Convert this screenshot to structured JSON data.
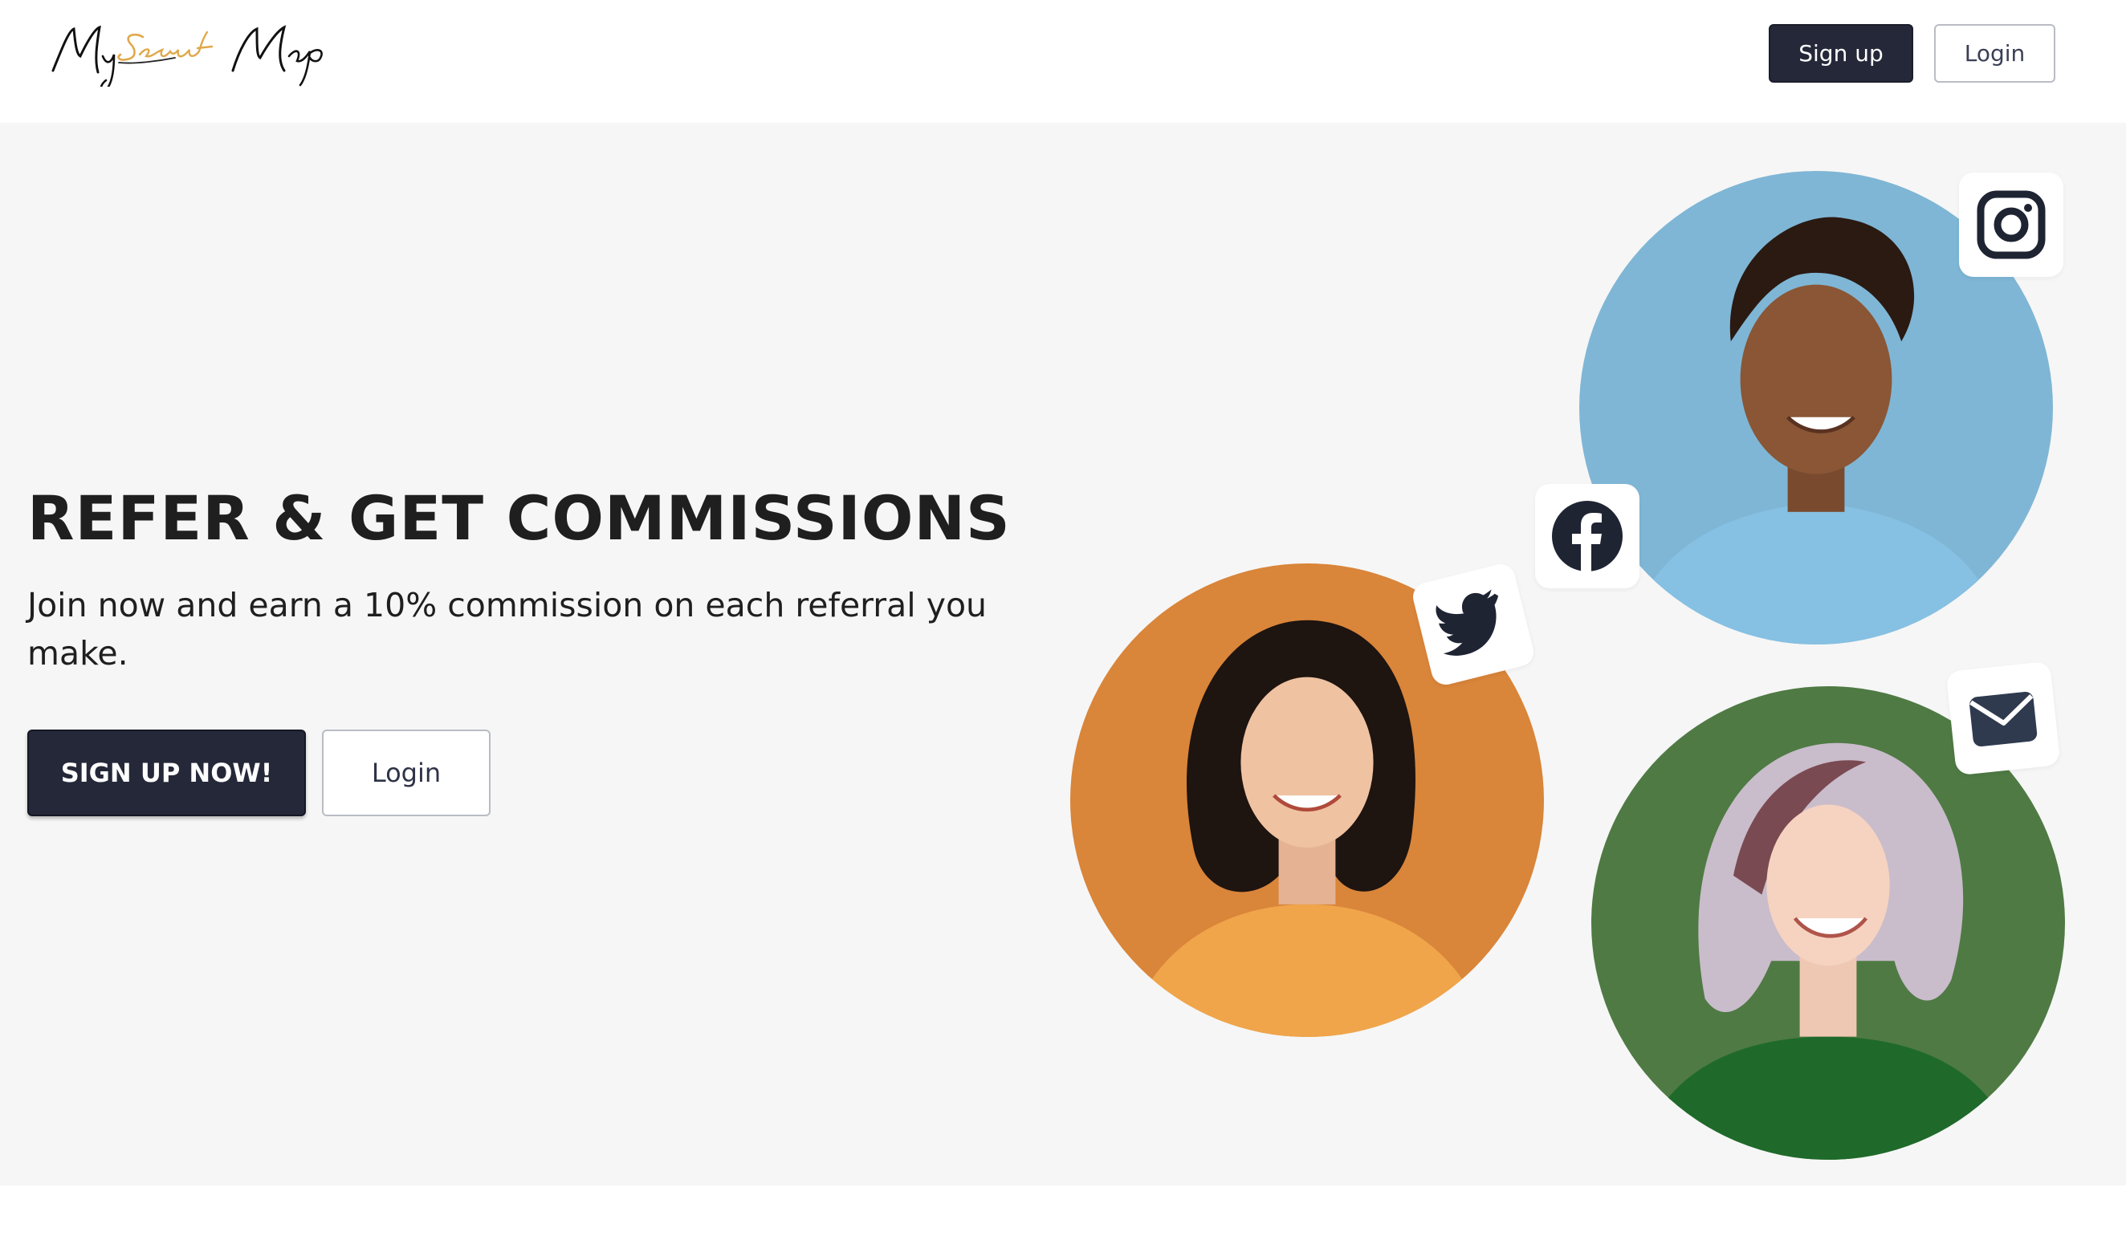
{
  "header": {
    "logo_text": "My Secret Map",
    "signup_label": "Sign up",
    "login_label": "Login"
  },
  "hero": {
    "title": "REFER & GET COMMISSIONS",
    "subtitle": "Join now and earn a 10% commission on each referral you make.",
    "cta_primary": "SIGN UP NOW!",
    "cta_secondary": "Login"
  },
  "social_icons": [
    "instagram-icon",
    "facebook-icon",
    "twitter-icon",
    "mail-icon"
  ],
  "colors": {
    "primary_button": "#252838",
    "hero_background": "#f6f6f6",
    "logo_accent": "#e0a84a",
    "portrait_blue": "#7fb6d5",
    "portrait_orange": "#d9853a",
    "portrait_green": "#4f7a44"
  }
}
